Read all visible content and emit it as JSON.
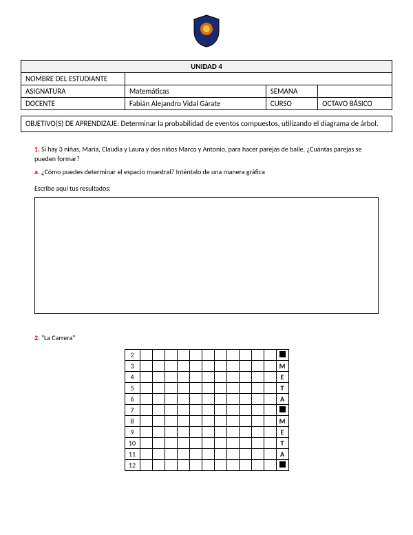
{
  "header": {
    "unit_title": "UNIDAD 4",
    "labels": {
      "student": "NOMBRE DEL ESTUDIANTE",
      "subject": "ASIGNATURA",
      "week": "SEMANA",
      "teacher": "DOCENTE",
      "course": "CURSO"
    },
    "values": {
      "student": "",
      "subject": "Matemáticas",
      "week": "",
      "teacher": "Fabián Alejandro Vidal Gárate",
      "course": "OCTAVO BÁSICO"
    }
  },
  "objective": {
    "label": "OBJETIVO(S) DE APRENDIZAJE:",
    "text": "Determinar la probabilidad de eventos compuestos, utilizando el diagrama de árbol."
  },
  "q1": {
    "num": "1.",
    "text": "Si hay 3 niñas, María, Claudia y Laura y dos niños Marco y Antonio, para hacer parejas de baile. ¿Cuántas parejas se pueden formar?",
    "a_num": "a.",
    "a_text": "¿Cómo puedes determinar el espacio muestral? Inténtalo de una manera gráfica",
    "write_here": "Escribe aquí tus resultados:"
  },
  "q2": {
    "num": "2.",
    "text": "\"La Carrera\""
  },
  "grid": {
    "rows": [
      2,
      3,
      4,
      5,
      6,
      7,
      8,
      9,
      10,
      11,
      12
    ],
    "cols": 11,
    "right_col": [
      "■",
      "M",
      "E",
      "T",
      "A",
      "■",
      "M",
      "E",
      "T",
      "A",
      "■"
    ]
  }
}
